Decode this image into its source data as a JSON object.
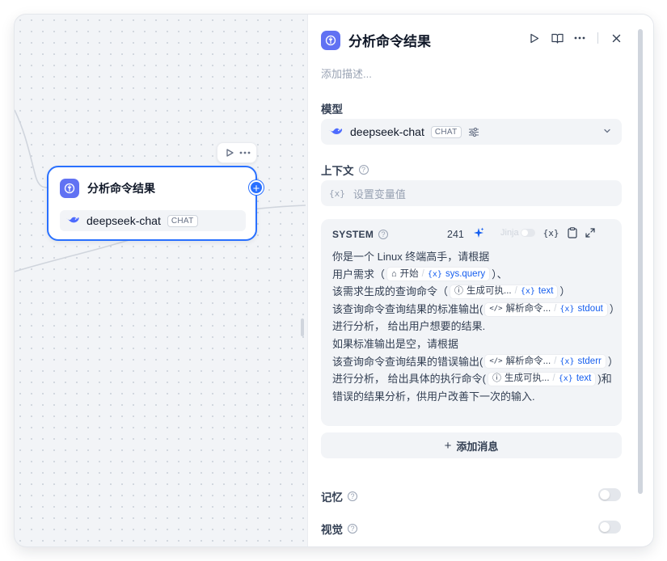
{
  "node": {
    "title": "分析命令结果",
    "model": "deepseek-chat",
    "mode_badge": "CHAT"
  },
  "panel": {
    "title": "分析命令结果",
    "description_placeholder": "添加描述...",
    "model_label": "模型",
    "model_name": "deepseek-chat",
    "model_badge": "CHAT",
    "context_label": "上下文",
    "context_placeholder": "设置变量值",
    "system": {
      "label": "SYSTEM",
      "count": "241",
      "jinja_label": "Jinja",
      "lines": {
        "l1": "你是一个 Linux 终端高手，请根据",
        "l2a": "用户需求（",
        "l2_node": "开始",
        "l2_var": "sys.query",
        "l2b": "）、",
        "l3a": "该需求生成的查询命令（",
        "l3_node": "生成可执...",
        "l3_var": "text",
        "l3b": "）",
        "l4a": "该查询命令查询结果的标准输出(",
        "l4_node": "解析命令...",
        "l4_var": "stdout",
        "l4b": "）",
        "l5": "进行分析， 给出用户想要的结果.",
        "l6": "如果标准输出是空，请根据",
        "l7a": "该查询命令查询结果的错误输出(",
        "l7_node": "解析命令...",
        "l7_var": "stderr",
        "l7b": "）",
        "l8a": "进行分析， 给出具体的执行命令(",
        "l8_node": "生成可执...",
        "l8_var": "text",
        "l8b": ")和",
        "l9": "错误的结果分析，供用户改善下一次的输入."
      }
    },
    "add_message_label": "添加消息",
    "memory_label": "记忆",
    "vision_label": "视觉"
  },
  "colors": {
    "accent": "#2970ff",
    "llm_icon": "#6172f3",
    "var_blue": "#155eef"
  }
}
